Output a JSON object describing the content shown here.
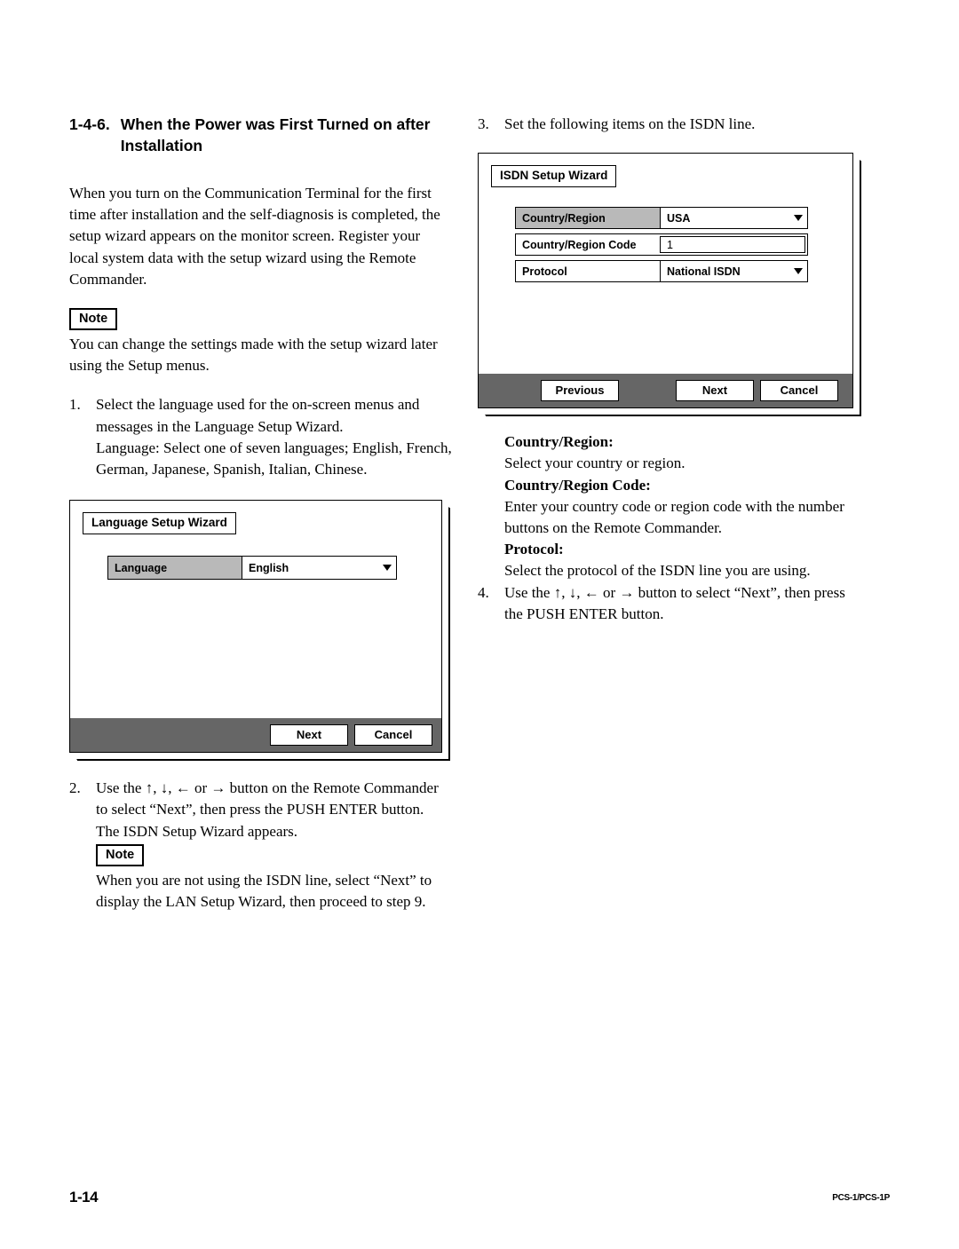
{
  "footer": {
    "page_number": "1-14",
    "document_id": "PCS-1/PCS-1P"
  },
  "left_column": {
    "heading": {
      "number": "1-4-6.",
      "title": "When the Power was First Turned on after Installation"
    },
    "intro_paragraph": "When you turn on the Communication Terminal for the first time after installation and the self-diagnosis is completed, the setup wizard appears on the monitor screen. Register your local system data with the setup wizard using the Remote Commander.",
    "note1": {
      "label": "Note",
      "text": "You can change the settings made with the setup wizard later using the Setup menus."
    },
    "step1": {
      "number": "1.",
      "line1": "Select the language used for the on-screen menus and messages in the Language Setup Wizard.",
      "line2": "Language: Select one of seven languages; English, French, German, Japanese, Spanish, Italian, Chinese."
    },
    "language_wizard": {
      "title": "Language Setup Wizard",
      "fields": [
        {
          "label": "Language",
          "value": "English",
          "type": "dropdown",
          "highlighted": true
        }
      ],
      "buttons": [
        "Next",
        "Cancel"
      ]
    },
    "step2": {
      "number": "2.",
      "line1": "Use the ↑, ↓, ← or → button on the Remote Commander to select “Next”, then press the PUSH ENTER button.",
      "line2": "The ISDN Setup Wizard appears."
    },
    "note2": {
      "label": "Note",
      "text": "When you are not using the ISDN line, select “Next” to display the LAN Setup Wizard, then proceed to step 9."
    }
  },
  "right_column": {
    "step3": {
      "number": "3.",
      "text": "Set the following items on the ISDN line."
    },
    "isdn_wizard": {
      "title": "ISDN Setup Wizard",
      "fields": [
        {
          "label": "Country/Region",
          "value": "USA",
          "type": "dropdown",
          "highlighted": true
        },
        {
          "label": "Country/Region Code",
          "value": "1",
          "type": "text",
          "highlighted": false
        },
        {
          "label": "Protocol",
          "value": "National ISDN",
          "type": "dropdown",
          "highlighted": false
        }
      ],
      "buttons": [
        "Previous",
        "Next",
        "Cancel"
      ]
    },
    "definitions": [
      {
        "term": "Country/Region:",
        "description": "Select your country or region."
      },
      {
        "term": "Country/Region Code:",
        "description": "Enter your country code or region code with the number buttons on the Remote Commander."
      },
      {
        "term": "Protocol:",
        "description": "Select the protocol of the ISDN line you are using."
      }
    ],
    "step4": {
      "number": "4.",
      "text": "Use the ↑, ↓, ← or → button to select “Next”, then press the PUSH ENTER button."
    }
  }
}
